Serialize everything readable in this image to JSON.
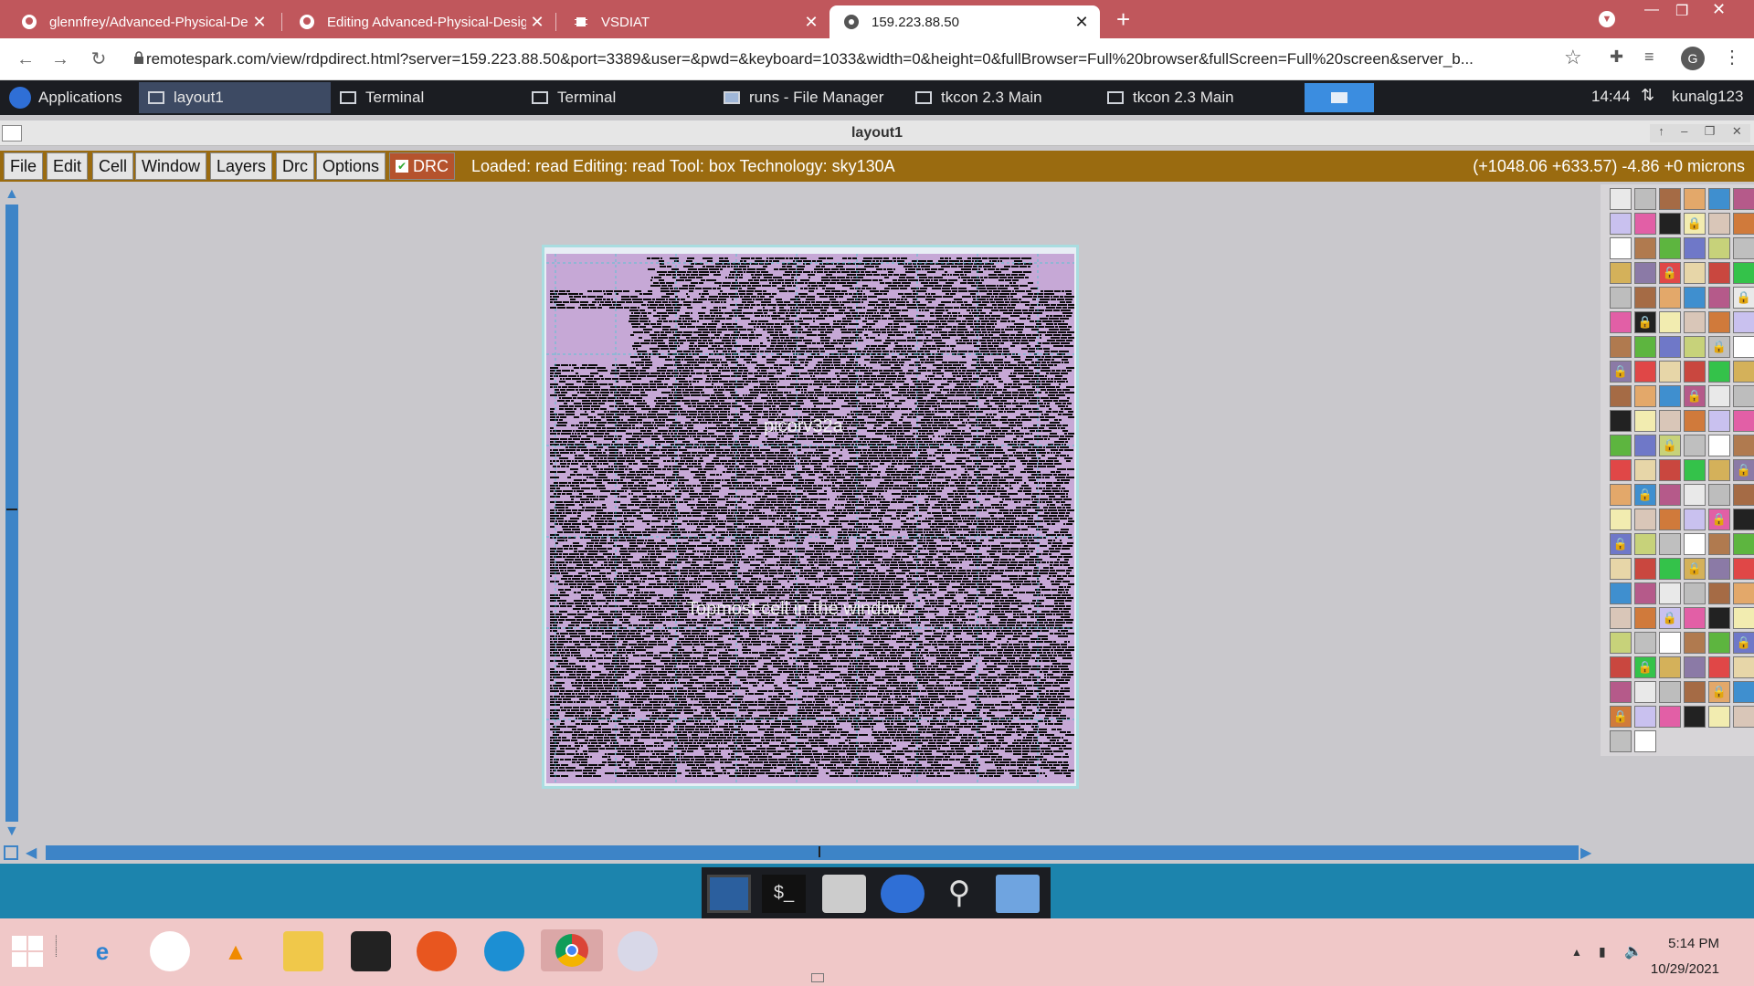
{
  "browser": {
    "tabs": [
      {
        "title": "glennfrey/Advanced-Physical-De",
        "icon": "github-icon",
        "active": false
      },
      {
        "title": "Editing Advanced-Physical-Desig",
        "icon": "github-icon",
        "active": false
      },
      {
        "title": "VSDIAT",
        "icon": "chip-icon",
        "active": false
      },
      {
        "title": "159.223.88.50",
        "icon": "globe-icon",
        "active": true
      }
    ],
    "url": "remotespark.com/view/rdpdirect.html?server=159.223.88.50&port=3389&user=&pwd=&keyboard=1033&width=0&height=0&fullBrowser=Full%20browser&fullScreen=Full%20screen&server_b...",
    "profile_initial": "G"
  },
  "xfce_panel": {
    "applications": "Applications",
    "tasks": [
      "layout1",
      "Terminal",
      "Terminal",
      "runs - File Manager",
      "tkcon 2.3 Main",
      "tkcon 2.3 Main"
    ],
    "active_task": "layout1",
    "time": "14:44",
    "user": "kunalg123"
  },
  "magic": {
    "window_title": "layout1",
    "menus": [
      "File",
      "Edit",
      "Cell",
      "Window",
      "Layers",
      "Drc",
      "Options"
    ],
    "drc_label": "DRC",
    "drc_checked": true,
    "status": "Loaded: read Editing: read Tool: box  Technology: sky130A",
    "coords": "(+1048.06 +633.57) -4.86 +0 microns",
    "cell_label": "picorv32a",
    "topmost_label": "Topmost cell in the window"
  },
  "windows_taskbar": {
    "time": "5:14 PM",
    "date": "10/29/2021"
  },
  "colors": {
    "tab_bar": "#c0575c",
    "menu_bar": "#9a6b10",
    "scroll_blue": "#3d84c7",
    "layout_bg": "#c6a8d6",
    "desktop": "#1c84ad"
  }
}
